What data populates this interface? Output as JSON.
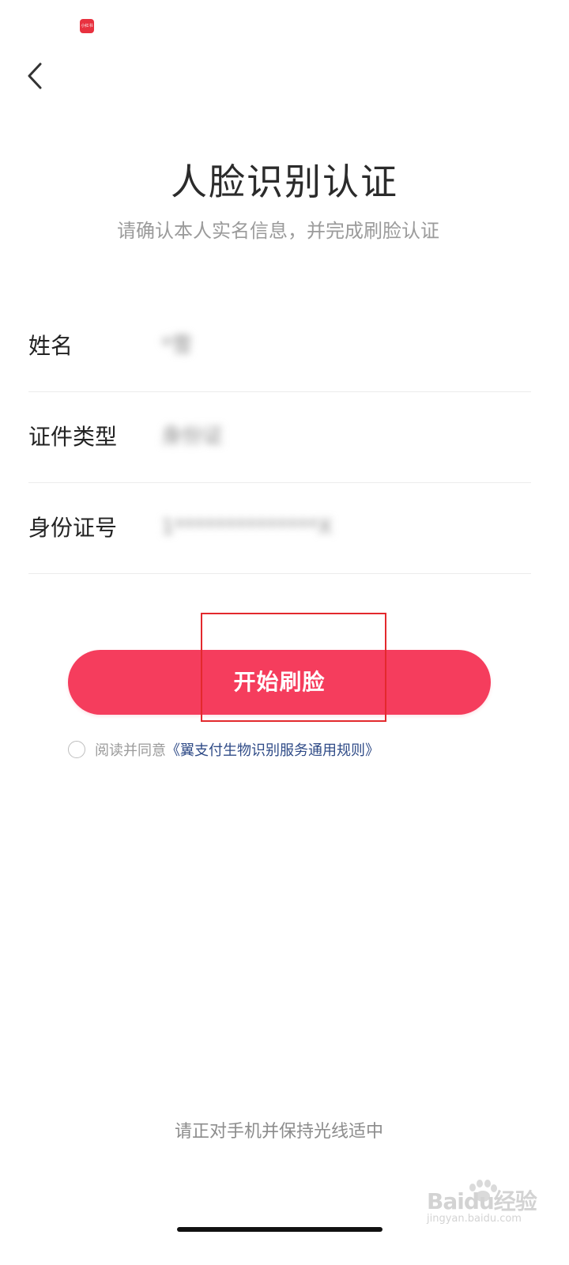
{
  "status_bar": {
    "app_icon_label": "小红书"
  },
  "header": {
    "back_icon": "chevron-left-icon"
  },
  "page": {
    "title": "人脸识别认证",
    "subtitle": "请确认本人实名信息，并完成刷脸认证"
  },
  "fields": [
    {
      "label": "姓名",
      "value": "*雪"
    },
    {
      "label": "证件类型",
      "value": "身份证"
    },
    {
      "label": "身份证号",
      "value": "1**************X"
    }
  ],
  "actions": {
    "start_label": "开始刷脸"
  },
  "agreement": {
    "prefix": "阅读并同意",
    "link": "《翼支付生物识别服务通用规则》"
  },
  "tip": "请正对手机并保持光线适中",
  "watermark": {
    "logo": "Baidu经验",
    "site": "jingyan.baidu.com"
  },
  "colors": {
    "primary_button": "#f53d5d",
    "link": "#2f4b87",
    "highlight_box": "#e3292d",
    "status_icon": "#e8313f"
  }
}
